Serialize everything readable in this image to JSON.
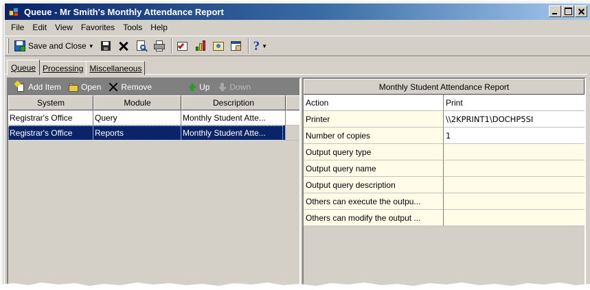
{
  "window": {
    "title": "Queue - Mr Smith's Monthly Attendance Report"
  },
  "menu": [
    {
      "label": "File"
    },
    {
      "label": "Edit"
    },
    {
      "label": "View"
    },
    {
      "label": "Favorites"
    },
    {
      "label": "Tools"
    },
    {
      "label": "Help"
    }
  ],
  "toolbar": {
    "save_close_label": "Save and Close",
    "help_glyph": "?"
  },
  "tabs": [
    {
      "label": "Queue",
      "active": true
    },
    {
      "label": "Processing",
      "active": false
    },
    {
      "label": "Miscellaneous",
      "active": false
    }
  ],
  "queue_toolbar": {
    "add_item": "Add Item",
    "open": "Open",
    "remove": "Remove",
    "up": "Up",
    "down": "Down"
  },
  "grid": {
    "columns": [
      "System",
      "Module",
      "Description"
    ],
    "rows": [
      {
        "system": "Registrar's Office",
        "module": "Query",
        "description": "Monthly Student Atte...",
        "selected": false
      },
      {
        "system": "Registrar's Office",
        "module": "Reports",
        "description": "Monthly Student Atte...",
        "selected": true
      }
    ]
  },
  "properties": {
    "header": "Monthly Student Attendance Report",
    "rows": [
      {
        "name": "Action",
        "value": "Print"
      },
      {
        "name": "Printer",
        "value": "\\\\2KPRINT1\\DOCHP5SI"
      },
      {
        "name": "Number of copies",
        "value": "1"
      },
      {
        "name": "Output query type",
        "value": ""
      },
      {
        "name": "Output query name",
        "value": ""
      },
      {
        "name": "Output query description",
        "value": ""
      },
      {
        "name": "Others can execute the outpu...",
        "value": ""
      },
      {
        "name": "Others can modify the output ...",
        "value": ""
      }
    ]
  },
  "colors": {
    "titlebar_start": "#0a246a",
    "titlebar_end": "#a6caf0",
    "selection": "#0a246a",
    "property_row_bg": "#fffce8",
    "face": "#d4d0c8"
  }
}
